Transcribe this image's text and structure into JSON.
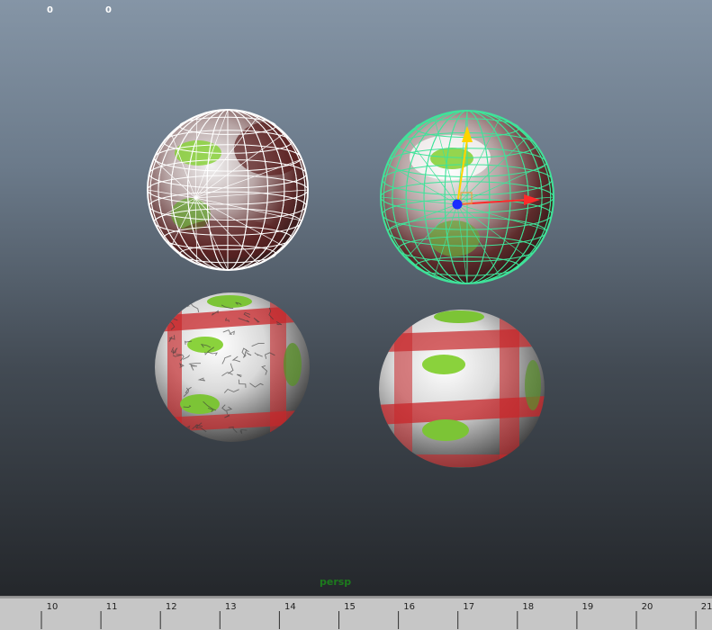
{
  "viewport": {
    "hud_counter_left": "0",
    "hud_counter_right": "0",
    "camera_label": "persp",
    "colors": {
      "selection_wire": "#3fe39a",
      "wire": "#ffffff",
      "axis_x": "#ff2a2a",
      "axis_y": "#ffd400",
      "axis_z": "#1a2cff",
      "camera_label": "#1d7b1d"
    }
  },
  "objects": [
    {
      "label": "sphere-wireframe-top-left",
      "selected": false
    },
    {
      "label": "sphere-wireframe-top-right",
      "selected": true
    },
    {
      "label": "sphere-shaded-bottom-left",
      "selected": false
    },
    {
      "label": "sphere-shaded-bottom-right",
      "selected": false
    }
  ],
  "timeline": {
    "ticks": [
      "10",
      "11",
      "12",
      "13",
      "14",
      "15",
      "16",
      "17",
      "18",
      "19",
      "20",
      "21"
    ]
  }
}
